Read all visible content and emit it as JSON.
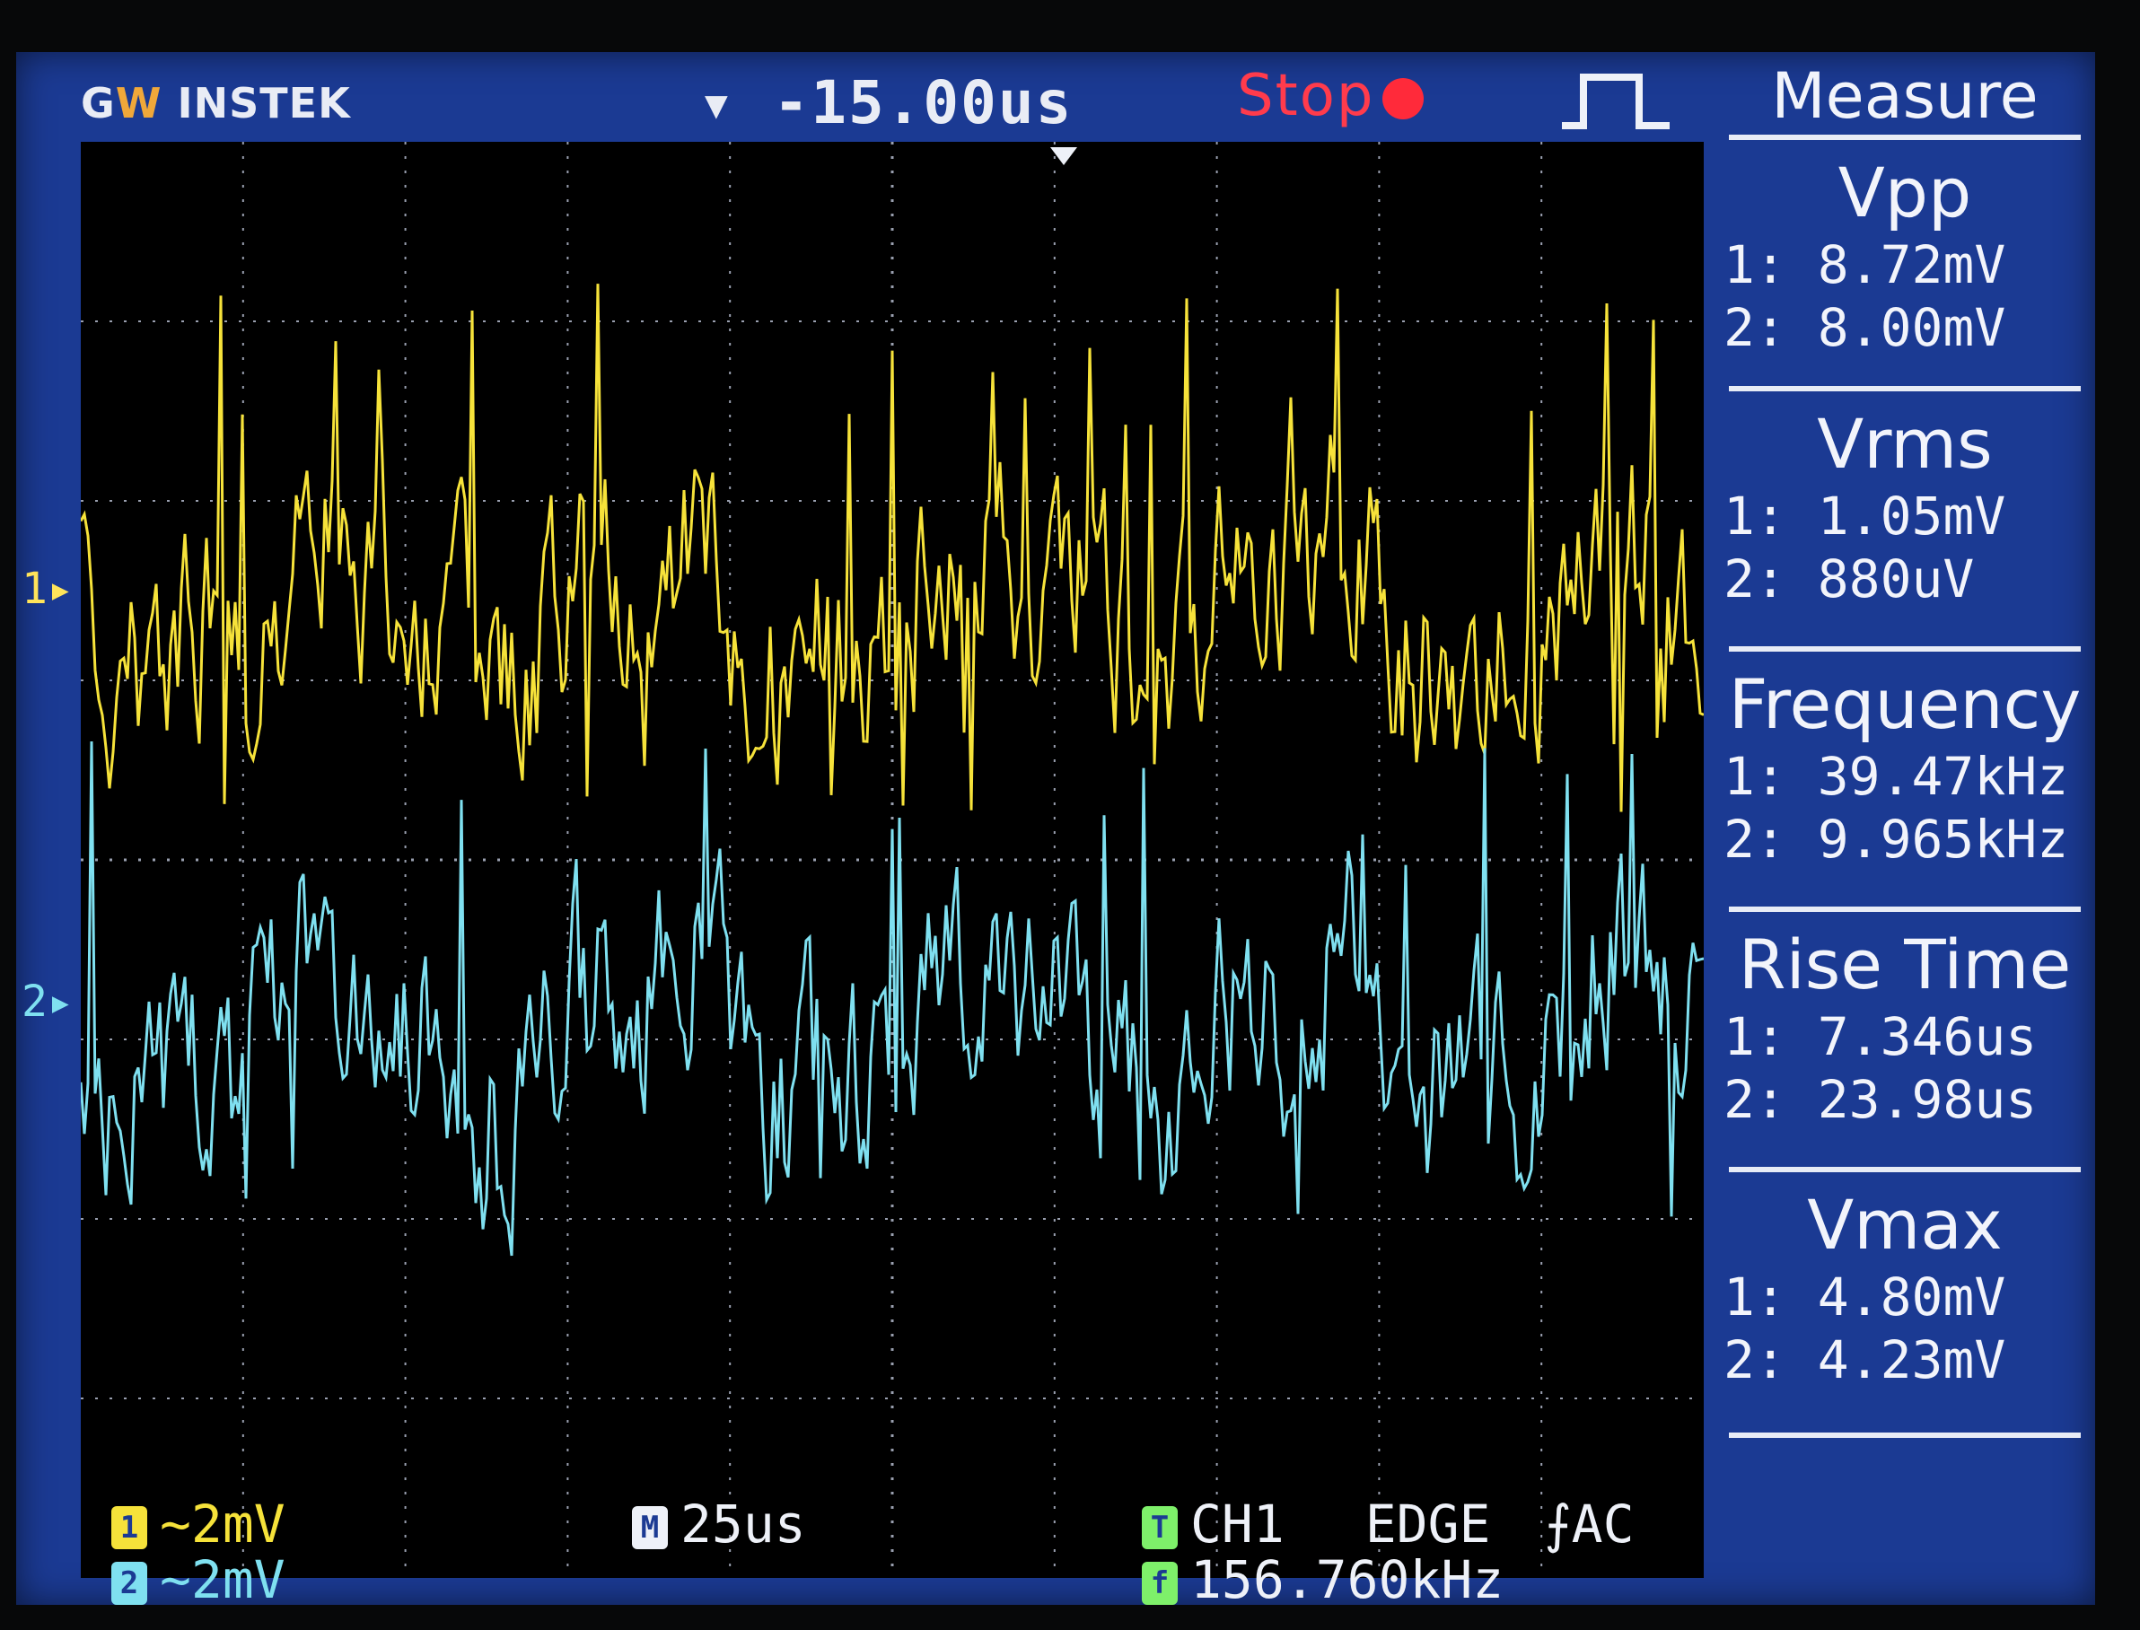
{
  "header": {
    "brand_prefix": "G",
    "brand_w": "W",
    "brand_suffix": "INSTEK",
    "time_offset": "▾ -15.00us",
    "run_status": "Stop",
    "trigger_icon": "pulse-icon"
  },
  "measure": {
    "title": "Measure",
    "items": [
      {
        "name": "Vpp",
        "ch1": "1: 8.72mV",
        "ch2": "2: 8.00mV"
      },
      {
        "name": "Vrms",
        "ch1": "1: 1.05mV",
        "ch2": "2: 880uV"
      },
      {
        "name": "Frequency",
        "ch1": "1: 39.47kHz",
        "ch2": "2: 9.965kHz"
      },
      {
        "name": "Rise Time",
        "ch1": "1: 7.346us",
        "ch2": "2: 23.98us"
      },
      {
        "name": "Vmax",
        "ch1": "1: 4.80mV",
        "ch2": "2: 4.23mV"
      }
    ]
  },
  "channels": {
    "ch1_marker": "1",
    "ch2_marker": "2"
  },
  "bottom": {
    "ch1_scale": "~2mV",
    "ch2_scale": "~2mV",
    "timebase": "25us",
    "trigger_source": "CH1",
    "trigger_type": "EDGE",
    "trigger_coupling": "AC",
    "trigger_freq": "156.760kHz",
    "ch1_badge": "1",
    "ch2_badge": "2",
    "time_badge": "M",
    "trig_badge": "T",
    "freq_badge": "f"
  },
  "colors": {
    "screen_bg": "#1b3a93",
    "ch1": "#f6e23a",
    "ch2": "#7fe0f0",
    "status": "#ff3b4c",
    "trigger_badge": "#7ef06a"
  }
}
